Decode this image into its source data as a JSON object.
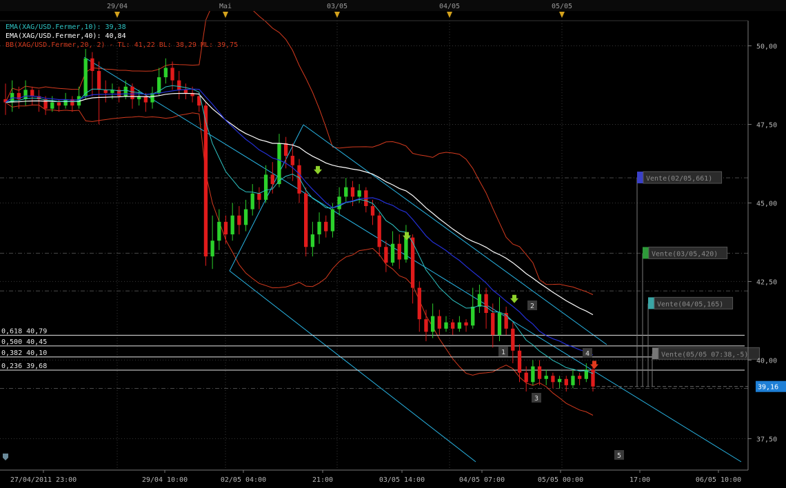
{
  "chart_data": {
    "type": "candlestick",
    "ylim": [
      36.5,
      50.8
    ],
    "y_ticks": [
      "37,50",
      "40,00",
      "42,50",
      "45,00",
      "47,50",
      "50,00"
    ],
    "y_tick_values": [
      37.5,
      40.0,
      42.5,
      45.0,
      47.5,
      50.0
    ],
    "top_dates": [
      "29/04",
      "Mai",
      "03/05",
      "04/05",
      "05/05"
    ],
    "x_time_labels": [
      "27/04/2011 23:00",
      "29/04 10:00",
      "02/05 04:00",
      "21:00",
      "03/05 14:00",
      "04/05 07:00",
      "05/05 00:00",
      "17:00",
      "06/05 10:00"
    ],
    "legend": [
      {
        "text": "EMA(XAG/USD.Fermer,10): 39,38",
        "color": "#2ec4c4"
      },
      {
        "text": "EMA(XAG/USD.Fermer,40): 40,84",
        "color": "#ffffff"
      },
      {
        "text": "BB(XAG/USD.Fermer,20, 2) -  TL: 41,22  BL: 38,29  ML: 39,75",
        "color": "#d43a1e"
      }
    ],
    "fib_levels": [
      {
        "label": "0,618 40,79",
        "value": 40.79
      },
      {
        "label": "0,500 40,45",
        "value": 40.45
      },
      {
        "label": "0,382 40,10",
        "value": 40.1
      },
      {
        "label": "0,236 39,68",
        "value": 39.68
      }
    ],
    "current_price": "39,16",
    "orders": [
      {
        "label": "Vente(02/05,661)",
        "price": 45.8,
        "color": "#3a40c8"
      },
      {
        "label": "Vente(03/05,420)",
        "price": 43.4,
        "color": "#2e9a3a"
      },
      {
        "label": "Vente(04/05,165)",
        "price": 41.8,
        "color": "#3aa5a5"
      },
      {
        "label": "Vente(05/05 07:38,-5)",
        "price": 40.2,
        "color": "#777777"
      }
    ],
    "wave_labels": [
      "1",
      "2",
      "3",
      "4",
      "5"
    ],
    "candles": [
      [
        48.3,
        48.2,
        48.8,
        47.8
      ],
      [
        48.2,
        48.5,
        48.9,
        47.9
      ],
      [
        48.5,
        48.3,
        48.7,
        48.0
      ],
      [
        48.3,
        48.6,
        48.9,
        48.1
      ],
      [
        48.6,
        48.4,
        48.7,
        48.1
      ],
      [
        48.4,
        48.3,
        48.6,
        47.9
      ],
      [
        48.3,
        48.0,
        48.4,
        47.8
      ],
      [
        48.0,
        48.2,
        48.4,
        47.9
      ],
      [
        48.2,
        48.1,
        48.3,
        47.9
      ],
      [
        48.1,
        48.3,
        48.5,
        48.0
      ],
      [
        48.3,
        48.1,
        48.4,
        47.9
      ],
      [
        48.1,
        48.4,
        48.7,
        48.0
      ],
      [
        48.4,
        49.6,
        49.9,
        48.3
      ],
      [
        49.6,
        49.2,
        49.8,
        48.4
      ],
      [
        49.2,
        48.6,
        49.5,
        47.5
      ],
      [
        48.6,
        48.5,
        48.9,
        48.2
      ],
      [
        48.5,
        48.6,
        48.8,
        48.3
      ],
      [
        48.6,
        48.4,
        48.7,
        48.2
      ],
      [
        48.4,
        48.7,
        48.9,
        48.3
      ],
      [
        48.7,
        48.3,
        48.8,
        48.0
      ],
      [
        48.3,
        48.4,
        48.6,
        48.1
      ],
      [
        48.4,
        48.2,
        48.5,
        47.9
      ],
      [
        48.2,
        48.5,
        48.7,
        48.0
      ],
      [
        48.5,
        49.0,
        49.3,
        48.4
      ],
      [
        49.0,
        49.3,
        49.6,
        48.8
      ],
      [
        49.3,
        48.9,
        49.5,
        48.6
      ],
      [
        48.9,
        48.6,
        49.2,
        48.3
      ],
      [
        48.6,
        48.5,
        48.8,
        48.3
      ],
      [
        48.5,
        48.4,
        48.7,
        48.2
      ],
      [
        48.4,
        48.1,
        48.5,
        47.9
      ],
      [
        48.1,
        43.3,
        48.2,
        43.0
      ],
      [
        43.3,
        43.8,
        44.6,
        42.9
      ],
      [
        43.8,
        44.4,
        44.8,
        43.5
      ],
      [
        44.4,
        44.0,
        44.6,
        43.7
      ],
      [
        44.0,
        44.6,
        45.0,
        43.8
      ],
      [
        44.6,
        44.3,
        44.9,
        44.0
      ],
      [
        44.3,
        44.8,
        45.1,
        44.1
      ],
      [
        44.8,
        45.3,
        45.6,
        44.6
      ],
      [
        45.3,
        45.1,
        45.5,
        44.8
      ],
      [
        45.1,
        45.9,
        46.2,
        45.0
      ],
      [
        45.9,
        45.6,
        46.3,
        45.3
      ],
      [
        45.6,
        46.9,
        47.2,
        45.5
      ],
      [
        46.9,
        46.5,
        47.1,
        46.1
      ],
      [
        46.5,
        46.2,
        46.9,
        45.7
      ],
      [
        46.2,
        45.3,
        46.4,
        45.0
      ],
      [
        45.3,
        43.6,
        45.5,
        43.3
      ],
      [
        43.6,
        44.0,
        44.4,
        43.3
      ],
      [
        44.0,
        44.4,
        44.7,
        43.7
      ],
      [
        44.4,
        44.1,
        44.6,
        43.9
      ],
      [
        44.1,
        44.8,
        45.0,
        43.9
      ],
      [
        44.8,
        45.2,
        45.5,
        44.6
      ],
      [
        45.2,
        45.5,
        45.8,
        45.0
      ],
      [
        45.5,
        45.2,
        45.7,
        44.9
      ],
      [
        45.2,
        45.4,
        45.6,
        45.0
      ],
      [
        45.4,
        44.9,
        45.5,
        44.7
      ],
      [
        44.9,
        44.6,
        45.1,
        44.3
      ],
      [
        44.6,
        43.6,
        44.7,
        43.3
      ],
      [
        43.6,
        43.1,
        43.8,
        42.8
      ],
      [
        43.1,
        43.7,
        44.1,
        43.0
      ],
      [
        43.7,
        43.2,
        44.0,
        42.9
      ],
      [
        43.2,
        43.9,
        44.3,
        43.1
      ],
      [
        43.9,
        42.3,
        44.0,
        41.8
      ],
      [
        42.3,
        41.3,
        42.5,
        40.9
      ],
      [
        41.3,
        40.9,
        41.6,
        40.6
      ],
      [
        40.9,
        41.4,
        41.8,
        40.7
      ],
      [
        41.4,
        41.0,
        41.6,
        40.8
      ],
      [
        41.0,
        41.2,
        41.4,
        40.9
      ],
      [
        41.2,
        41.0,
        41.3,
        40.8
      ],
      [
        41.0,
        41.2,
        41.4,
        40.9
      ],
      [
        41.2,
        41.1,
        41.3,
        40.9
      ],
      [
        41.1,
        41.7,
        42.3,
        41.0
      ],
      [
        41.7,
        42.1,
        42.4,
        41.5
      ],
      [
        42.1,
        41.5,
        42.3,
        41.0
      ],
      [
        41.5,
        40.8,
        41.8,
        40.4
      ],
      [
        40.8,
        41.5,
        42.0,
        40.6
      ],
      [
        41.5,
        41.0,
        41.7,
        40.8
      ],
      [
        41.0,
        40.3,
        41.2,
        39.9
      ],
      [
        40.3,
        39.6,
        40.5,
        39.3
      ],
      [
        39.6,
        39.3,
        39.8,
        39.0
      ],
      [
        39.3,
        39.8,
        40.0,
        39.2
      ],
      [
        39.8,
        39.4,
        40.0,
        39.2
      ],
      [
        39.4,
        39.5,
        39.7,
        39.2
      ],
      [
        39.5,
        39.3,
        39.6,
        39.1
      ],
      [
        39.3,
        39.4,
        39.5,
        39.1
      ],
      [
        39.4,
        39.2,
        39.5,
        39.0
      ],
      [
        39.2,
        39.5,
        39.7,
        39.1
      ],
      [
        39.5,
        39.4,
        39.6,
        39.2
      ],
      [
        39.4,
        39.7,
        39.9,
        39.3
      ],
      [
        39.7,
        39.16,
        39.8,
        39.0
      ]
    ]
  }
}
